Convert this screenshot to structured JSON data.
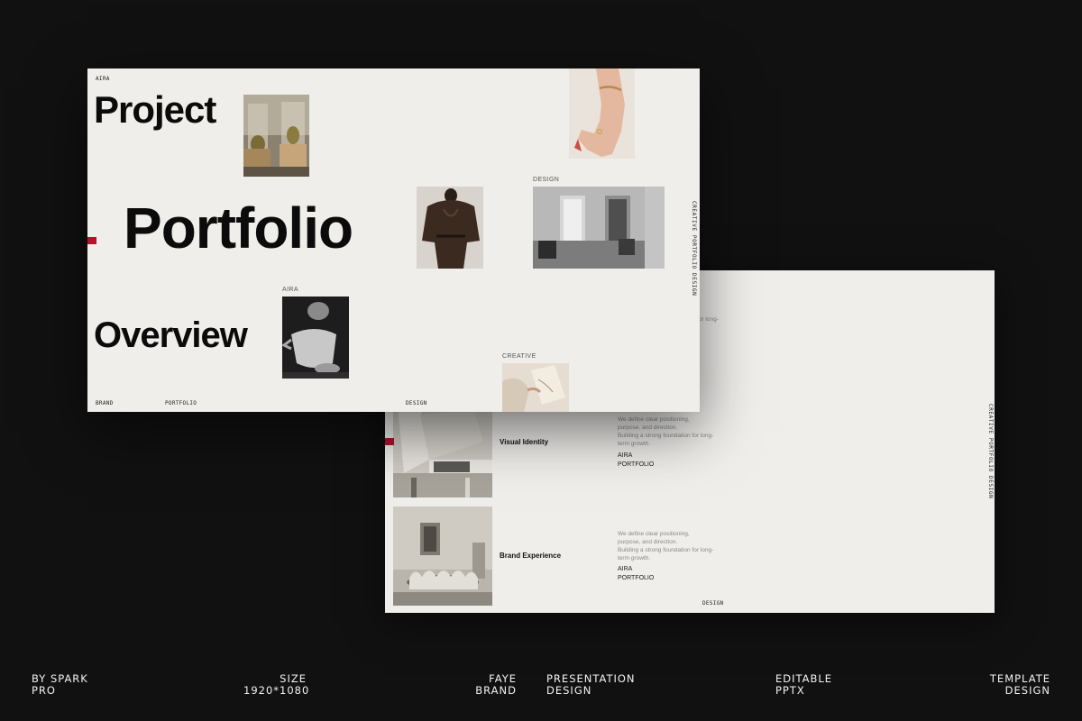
{
  "back_slide": {
    "vertical_text": "CREATIVE PORTFOLIO DESIGN",
    "top_desc_fragment": "for long-",
    "rows": [
      {
        "title": "Visual Identity",
        "desc_lines": [
          "We define clear positioning,",
          "purpose, and direction.",
          "Building a strong foundation for long-",
          "term growth."
        ],
        "meta_lines": [
          "AIRA",
          "PORTFOLIO"
        ]
      },
      {
        "title": "Brand Experience",
        "desc_lines": [
          "We define clear positioning,",
          "purpose, and direction.",
          "Building a strong foundation for long-",
          "term growth."
        ],
        "meta_lines": [
          "AIRA",
          "PORTFOLIO"
        ]
      }
    ],
    "footer_label": "DESIGN"
  },
  "front_slide": {
    "top_label": "AIRA",
    "word_1": "Project",
    "word_2": "Portfolio",
    "word_3": "Overview",
    "label_design": "DESIGN",
    "label_aira": "AIRA",
    "label_creative": "CREATIVE",
    "vertical_text": "CREATIVE PORTFOLIO DESIGN",
    "footer": {
      "brand": "BRAND",
      "portfolio": "PORTFOLIO",
      "design": "DESIGN"
    }
  },
  "bottom_bar": [
    {
      "line1": "BY SPARK",
      "line2": "PRO"
    },
    {
      "line1": "SIZE",
      "line2": "1920*1080"
    },
    {
      "line1": "FAYE",
      "line2": "BRAND"
    },
    {
      "line1": "PRESENTATION",
      "line2": "DESIGN"
    },
    {
      "line1": "EDITABLE",
      "line2": "PPTX"
    },
    {
      "line1": "TEMPLATE",
      "line2": "DESIGN"
    }
  ],
  "colors": {
    "background": "#111111",
    "slide": "#efeeeb",
    "accent_red": "#b0152a"
  }
}
